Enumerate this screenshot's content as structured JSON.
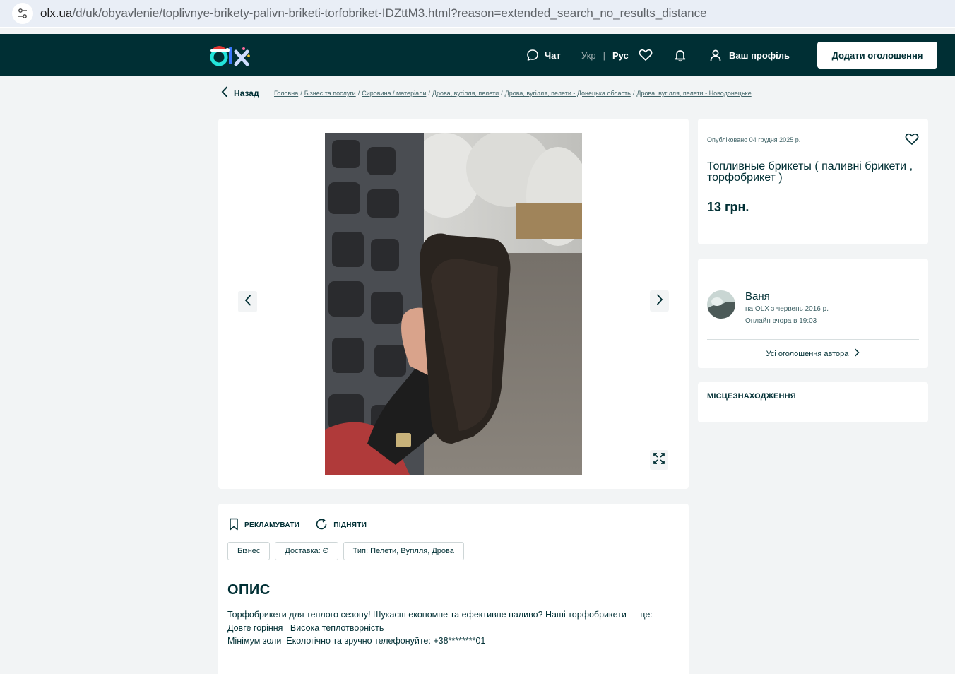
{
  "browser": {
    "url_host": "olx.ua",
    "url_path": "/d/uk/obyavlenie/toplivnye-brikety-palivn-briketi-torfobriket-IDZttM3.html?reason=extended_search_no_results_distance"
  },
  "header": {
    "chat_label": "Чат",
    "lang_ukr": "Укр",
    "lang_sep": "|",
    "lang_rus": "Рус",
    "profile_label": "Ваш профіль",
    "add_button_label": "Додати оголошення",
    "brand_color": "#002f34"
  },
  "breadcrumb": {
    "back_label": "Назад",
    "items": [
      "Головна",
      "Бізнес та послуги",
      "Сировина / матеріали",
      "Дрова, вугілля, пелети",
      "Дрова, вугілля, пелети - Донецька область",
      "Дрова, вугілля, пелети - Новодонецьке"
    ]
  },
  "ad": {
    "posted": "Опубліковано 04 грудня 2025 р.",
    "title": "Топливные брикеты ( паливні брикети , торфобрикет )",
    "price": "13 грн."
  },
  "seller": {
    "name": "Ваня",
    "since": "на OLX з червень 2016 р.",
    "online": "Онлайн вчора в 19:03",
    "all_ads_label": "Усі оголошення автора"
  },
  "location": {
    "title": "МІСЦЕЗНАХОДЖЕННЯ"
  },
  "details": {
    "promote_label": "РЕКЛАМУВАТИ",
    "raise_label": "ПІДНЯТИ",
    "tags": [
      "Бізнес",
      "Доставка: Є",
      "Тип: Пелети, Вугілля, Дрова"
    ],
    "description_title": "ОПИС",
    "description_lines": [
      "Торфобрикети для теплого сезону! Шукаєш економне та ефективне паливо? Наші торфобрикети — це:",
      "Довге горіння   Висока теплотворність",
      "Мінімум золи  Екологічно та зручно телефонуйте: +38********01"
    ]
  }
}
